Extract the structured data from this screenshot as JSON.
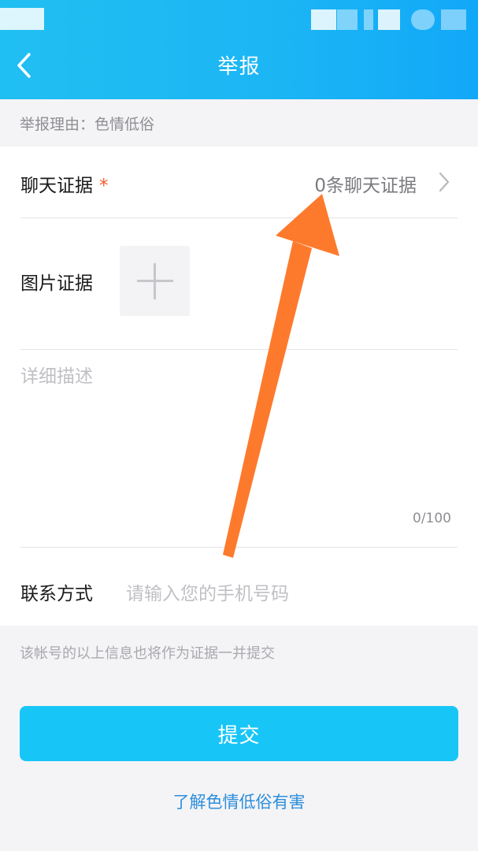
{
  "header": {
    "title": "举报",
    "color": "#1cb6f4"
  },
  "reason": {
    "text": "举报理由：色情低俗"
  },
  "chat_evidence": {
    "label": "聊天证据",
    "required_mark": "*",
    "value": "0条聊天证据"
  },
  "image_evidence": {
    "label": "图片证据"
  },
  "description": {
    "placeholder": "详细描述",
    "counter": "0/100"
  },
  "contact": {
    "label": "联系方式",
    "placeholder": "请输入您的手机号码"
  },
  "notice": {
    "text": "该帐号的以上信息也将作为证据一并提交"
  },
  "submit": {
    "label": "提交",
    "color": "#18c5f7"
  },
  "learn_more": {
    "label": "了解色情低俗有害"
  },
  "annotation": {
    "arrow_color": "#fd7a2d"
  }
}
